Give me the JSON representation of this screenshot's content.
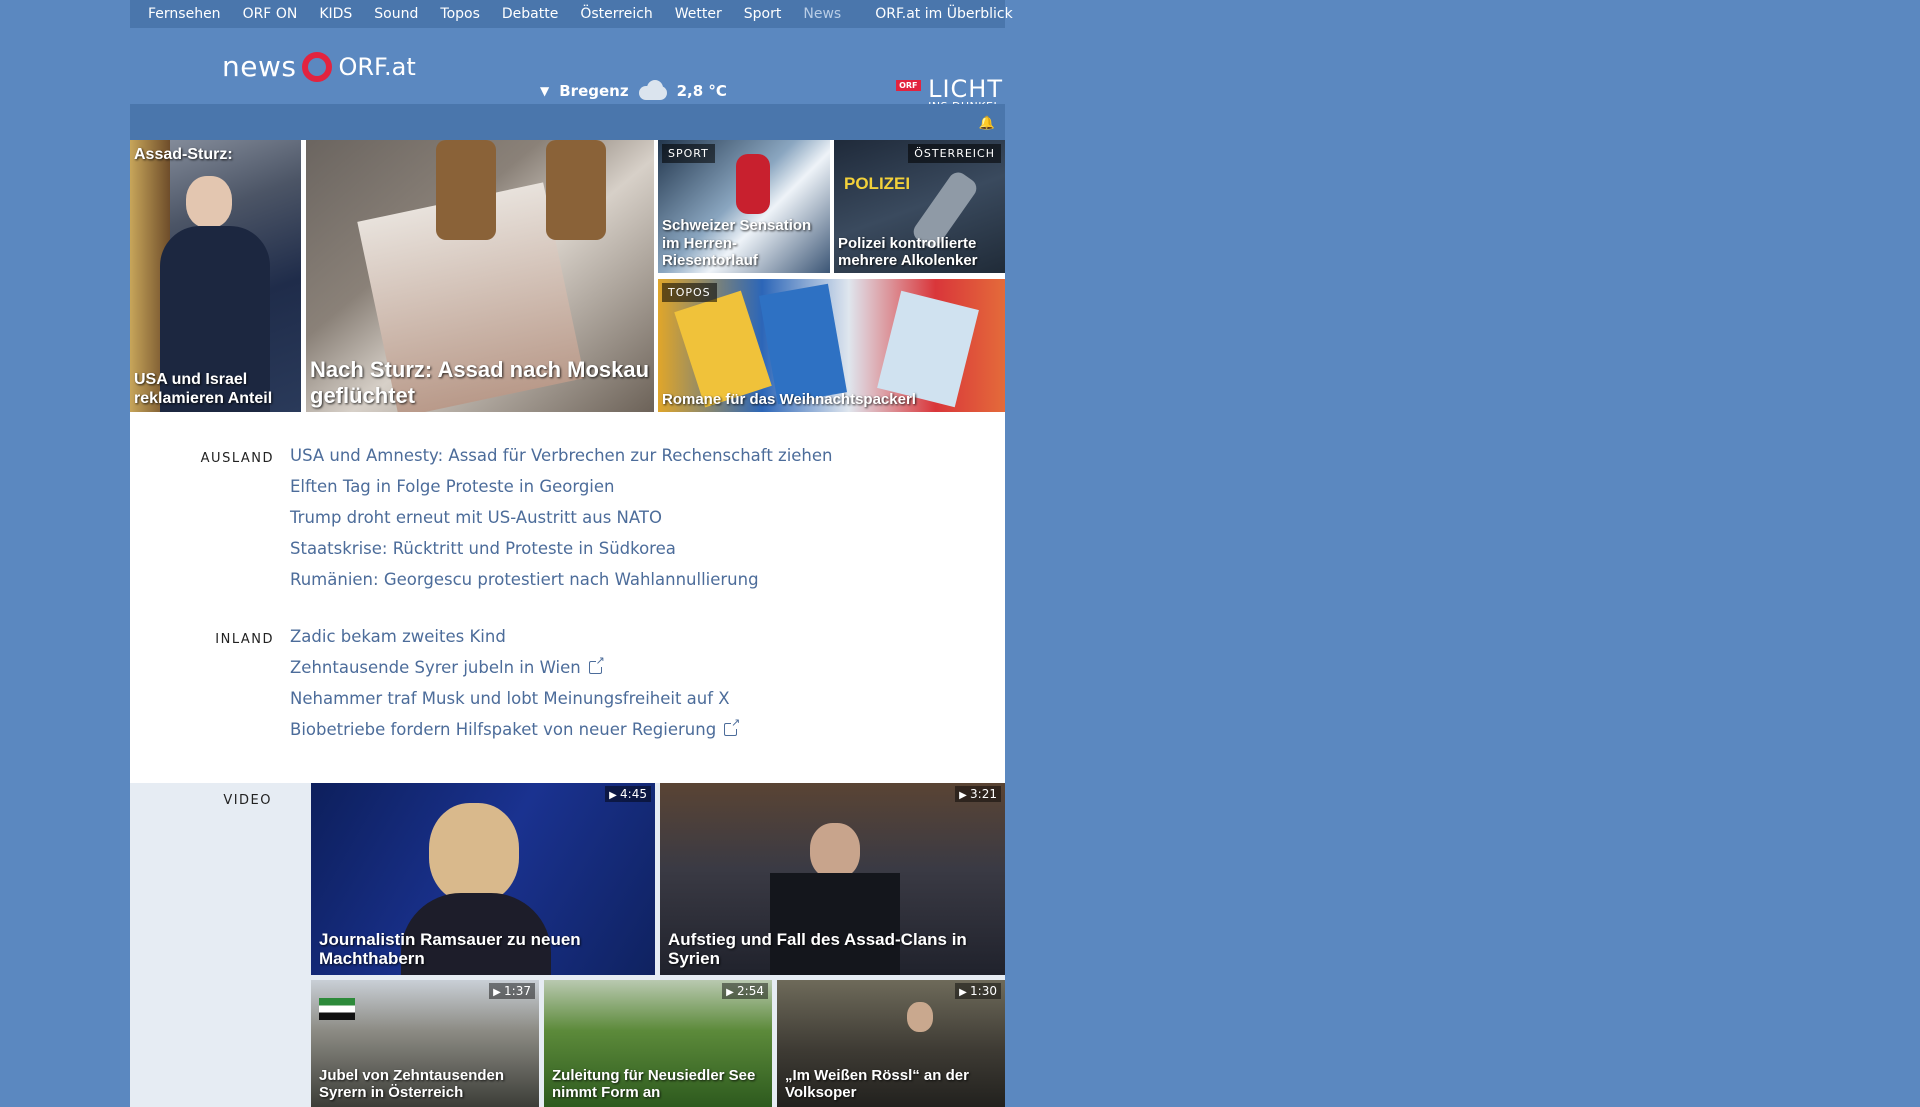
{
  "nav": {
    "items": [
      "Fernsehen",
      "ORF ON",
      "KIDS",
      "Sound",
      "Topos",
      "Debatte",
      "Österreich",
      "Wetter",
      "Sport",
      "News"
    ],
    "active": "News",
    "overview": "ORF.at im Überblick"
  },
  "header": {
    "logo_news": "news",
    "logo_orf": "ORF.at",
    "weather_city": "Bregenz",
    "weather_temp": "2,8 °C",
    "weather_icon": "cloud-rain-icon",
    "licht_badge": "ORF",
    "licht_big": "LICHT",
    "licht_small": "INS DUNKEL"
  },
  "hero": {
    "kicker": "Assad-Sturz:",
    "t1": "USA und Israel reklamieren Anteil",
    "t2": "Nach Sturz: Assad nach Moskau geflüchtet",
    "t3_cat": "SPORT",
    "t3": "Schweizer Sensation im Herren-Riesentorlauf",
    "t4_cat": "ÖSTERREICH",
    "t4": "Polizei kontrollierte mehrere Alkolenker",
    "t4_sign": "POLIZEI",
    "t5_cat": "TOPOS",
    "t5": "Romane für das Weihnachtspackerl"
  },
  "ausland": {
    "label": "AUSLAND",
    "items": [
      "USA und Amnesty: Assad für Verbrechen zur Rechenschaft ziehen",
      "Elften Tag in Folge Proteste in Georgien",
      "Trump droht erneut mit US-Austritt aus NATO",
      "Staatskrise: Rücktritt und Proteste in Südkorea",
      "Rumänien: Georgescu protestiert nach Wahlannullierung"
    ]
  },
  "inland": {
    "label": "INLAND",
    "items": [
      "Zadic bekam zweites Kind",
      "Zehntausende Syrer jubeln in Wien",
      "Nehammer traf Musk und lobt Meinungsfreiheit auf X",
      "Biobetriebe fordern Hilfspaket von neuer Regierung"
    ]
  },
  "video": {
    "label": "VIDEO",
    "v1": {
      "title": "Journalistin Ramsauer zu neuen Machthabern",
      "dur": "4:45"
    },
    "v2": {
      "title": "Aufstieg und Fall des Assad-Clans in Syrien",
      "dur": "3:21"
    },
    "v3": {
      "title": "Jubel von Zehntausenden Syrern in Österreich",
      "dur": "1:37"
    },
    "v4": {
      "title": "Zuleitung für Neusiedler See nimmt Form an",
      "dur": "2:54"
    },
    "v5": {
      "title": "„Im Weißen Rössl“ an der Volksoper",
      "dur": "1:30"
    }
  }
}
